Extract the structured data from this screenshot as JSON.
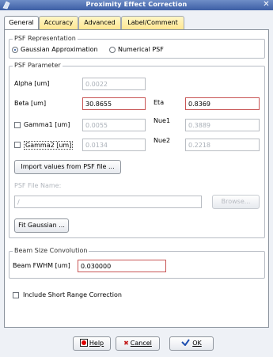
{
  "window": {
    "title": "Proximity Effect Correction"
  },
  "tabs": [
    {
      "label": "General"
    },
    {
      "label": "Accuracy"
    },
    {
      "label": "Advanced"
    },
    {
      "label": "Label/Comment"
    }
  ],
  "psf_representation": {
    "title": "PSF Representation",
    "option_gaussian": "Gaussian Approximation",
    "option_numerical": "Numerical PSF",
    "selected": "Gaussian Approximation"
  },
  "psf_parameter": {
    "title": "PSF Parameter",
    "alpha_label": "Alpha [um]",
    "alpha_value": "0.0022",
    "beta_label": "Beta [um]",
    "beta_value": "30.8655",
    "eta_label": "Eta",
    "eta_value": "0.8369",
    "gamma1_label": "Gamma1 [um]",
    "gamma1_value": "0.0055",
    "nue1_label": "Nue1",
    "nue1_value": "0.3889",
    "gamma2_label": "Gamma2 [um]",
    "gamma2_value": "0.0134",
    "nue2_label": "Nue2",
    "nue2_value": "0.2218",
    "import_button": "Import values from PSF file ...",
    "file_name_label": "PSF File Name:",
    "file_name_value": "/",
    "browse_button": "Browse...",
    "fit_button": "Fit Gaussian ..."
  },
  "beam_size": {
    "title": "Beam Size Convolution",
    "fwhm_label": "Beam FWHM [um]",
    "fwhm_value": "0.030000"
  },
  "short_range": {
    "label": "Include Short Range Correction"
  },
  "buttons": {
    "help": "Help",
    "cancel": "Cancel",
    "ok": "OK"
  }
}
